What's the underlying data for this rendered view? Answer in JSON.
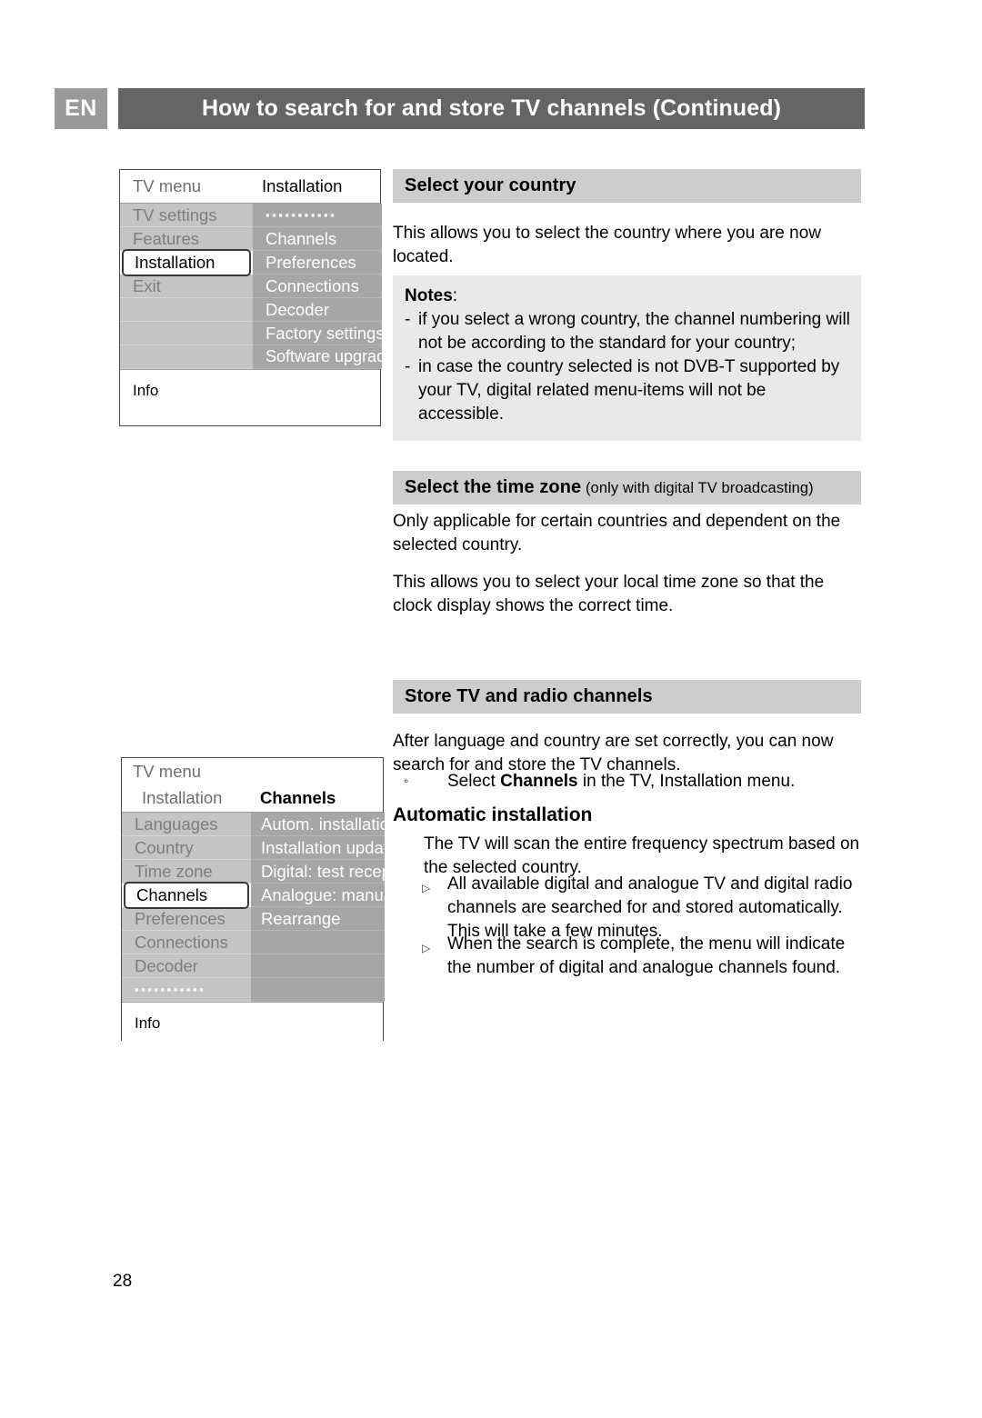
{
  "header": {
    "language_badge": "EN",
    "title": "How to search for and store TV channels  (Continued)"
  },
  "page_number": "28",
  "menu_diagram_1": {
    "title_left": "TV menu",
    "title_right": "Installation",
    "left_items": [
      "TV settings",
      "Features",
      "Installation",
      "Exit"
    ],
    "left_selected": "Installation",
    "right_items": [
      "…………",
      "Channels",
      "Preferences",
      "Connections",
      "Decoder",
      "Factory settings",
      "Software upgrade"
    ],
    "right_first_is_dots": true,
    "info_label": "Info"
  },
  "menu_diagram_2": {
    "title_top": "TV menu",
    "title_left": "Installation",
    "title_right": "Channels",
    "left_items": [
      "Languages",
      "Country",
      "Time zone",
      "Channels",
      "Preferences",
      "Connections",
      "Decoder",
      "…………"
    ],
    "left_selected": "Channels",
    "left_last_is_dots": true,
    "right_items": [
      "Autom. installation",
      "Installation update",
      "Digital: test recept..",
      "Analogue: manual..",
      "Rearrange"
    ],
    "info_label": "Info"
  },
  "sections": {
    "select_country": {
      "heading": "Select your country",
      "paragraph": "This allows you to select the country where you are now located.",
      "notes_title": "Notes",
      "notes_colon": ":",
      "notes": [
        "if you select a wrong country, the channel numbering will not be according to the standard for your country;",
        "in case the country selected is not DVB-T supported by your TV, digital related menu-items will not be accessible."
      ]
    },
    "time_zone": {
      "heading": "Select the time zone",
      "heading_sub": " (only with digital TV broadcasting)",
      "paragraph_1": "Only applicable for certain countries and dependent on the selected country.",
      "paragraph_2": "This allows you to select your local time zone so that the clock display shows the correct time."
    },
    "store_channels": {
      "heading": "Store TV and radio channels",
      "paragraph": "After language and country are set correctly, you can now search for and store the TV channels.",
      "bullet_marker": "◦",
      "bullet_pre": "Select ",
      "bullet_bold": "Channels",
      "bullet_post": " in the TV, Installation menu."
    },
    "automatic_installation": {
      "heading": "Automatic installation",
      "paragraph": "The TV will scan the entire frequency spectrum based on the selected country.",
      "bullet_marker": "▷",
      "bullets": [
        "All available digital and analogue TV and digital radio channels are searched for and stored automatically. This will take a few minutes.",
        "When the search is complete, the menu will indicate the number of digital and analogue channels found."
      ]
    }
  }
}
